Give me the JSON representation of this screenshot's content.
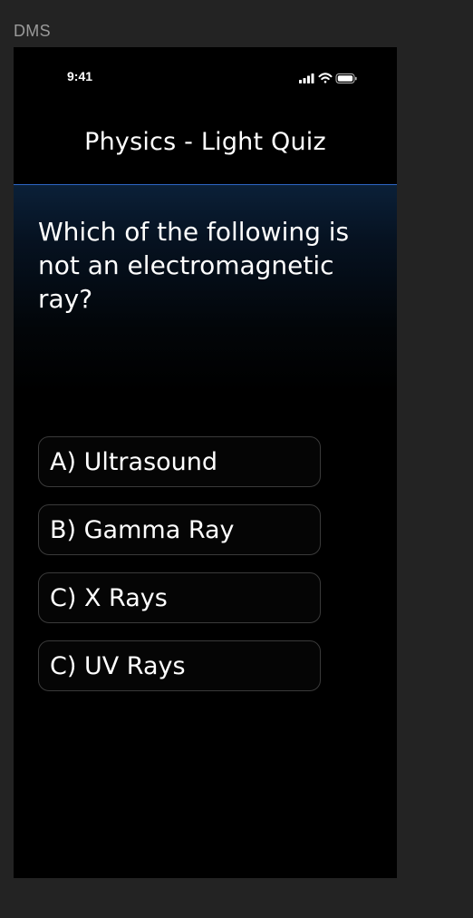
{
  "canvas": {
    "label": "DMS"
  },
  "status_bar": {
    "time": "9:41",
    "icons": [
      "cellular-signal-icon",
      "wifi-icon",
      "battery-icon"
    ]
  },
  "header": {
    "title": "Physics - Light Quiz"
  },
  "quiz": {
    "question": "Which of the following is not an electromagnetic ray?",
    "options": [
      {
        "label": "A) Ultrasound"
      },
      {
        "label": "B) Gamma Ray"
      },
      {
        "label": "C) X Rays"
      },
      {
        "label": "C) UV Rays"
      }
    ]
  },
  "colors": {
    "background": "#000000",
    "header_divider": "#2d66c4",
    "option_border": "#3a3a3a",
    "text": "#ffffff",
    "canvas": "#232323"
  }
}
